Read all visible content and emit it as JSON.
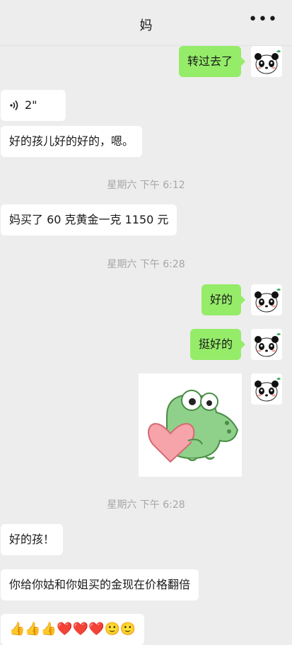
{
  "header": {
    "title": "妈",
    "more_label": "•••"
  },
  "messages": {
    "m1": "转过去了",
    "voice_duration": "2\"",
    "m2": "好的孩儿好的好的，嗯。",
    "t1": "星期六 下午 6:12",
    "m3": "妈买了 60 克黄金一克 1150 元",
    "t2": "星期六 下午 6:28",
    "m4": "好的",
    "m5": "挺好的",
    "t3": "星期六 下午 6:28",
    "m6": "好的孩！",
    "m7": "你给你姑和你姐买的金现在价格翻倍",
    "m8": "👍👍👍❤️❤️❤️🙂🙂"
  },
  "colors": {
    "background": "#ededed",
    "outgoing_bubble": "#95ec69",
    "incoming_bubble": "#ffffff"
  },
  "icons": {
    "avatar": "panda-avatar-icon",
    "voice": "voice-wave-icon",
    "sticker": "crocodile-heart-sticker"
  }
}
